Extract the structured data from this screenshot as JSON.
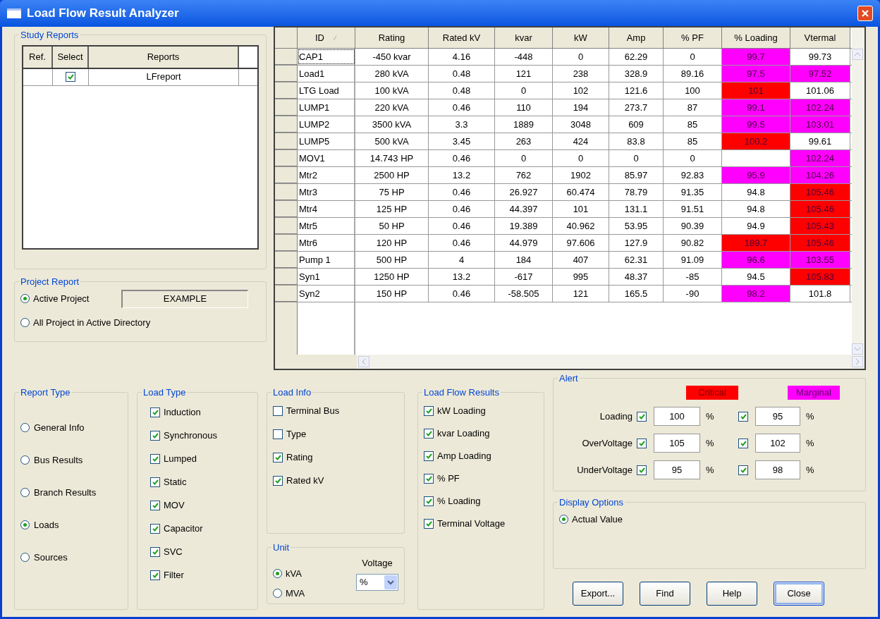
{
  "window": {
    "title": "Load Flow Result Analyzer"
  },
  "study_reports": {
    "title": "Study Reports",
    "columns": [
      "Ref.",
      "Select",
      "Reports"
    ],
    "rows": [
      {
        "select": true,
        "report": "LFreport"
      }
    ]
  },
  "project_report": {
    "title": "Project Report",
    "options": [
      {
        "label": "Active Project",
        "selected": true
      },
      {
        "label": "All Project in Active Directory",
        "selected": false
      }
    ],
    "project_name": "EXAMPLE"
  },
  "results_table": {
    "columns": [
      "ID",
      "Rating",
      "Rated kV",
      "kvar",
      "kW",
      "Amp",
      "% PF",
      "% Loading",
      "Vtermal"
    ],
    "rows": [
      {
        "focused": true,
        "cells": [
          "CAP1",
          "-450 kvar",
          "4.16",
          "-448",
          "0",
          "62.29",
          "0"
        ],
        "loading": {
          "text": "99.7",
          "color": "#ff00ff"
        },
        "vtermal": {
          "text": "99.73",
          "color": "#ffffff"
        }
      },
      {
        "focused": false,
        "cells": [
          "Load1",
          "280 kVA",
          "0.48",
          "121",
          "238",
          "328.9",
          "89.16"
        ],
        "loading": {
          "text": "97.5",
          "color": "#ff00ff"
        },
        "vtermal": {
          "text": "97.52",
          "color": "#ff00ff"
        }
      },
      {
        "focused": false,
        "cells": [
          "LTG Load",
          "100 kVA",
          "0.48",
          "0",
          "102",
          "121.6",
          "100"
        ],
        "loading": {
          "text": "101",
          "color": "#ff0000"
        },
        "vtermal": {
          "text": "101.06",
          "color": "#ffffff"
        }
      },
      {
        "focused": false,
        "cells": [
          "LUMP1",
          "220 kVA",
          "0.46",
          "110",
          "194",
          "273.7",
          "87"
        ],
        "loading": {
          "text": "99.1",
          "color": "#ff00ff"
        },
        "vtermal": {
          "text": "102.24",
          "color": "#ff00ff"
        }
      },
      {
        "focused": false,
        "cells": [
          "LUMP2",
          "3500 kVA",
          "3.3",
          "1889",
          "3048",
          "609",
          "85"
        ],
        "loading": {
          "text": "99.5",
          "color": "#ff00ff"
        },
        "vtermal": {
          "text": "103.01",
          "color": "#ff00ff"
        }
      },
      {
        "focused": false,
        "cells": [
          "LUMP5",
          "500 kVA",
          "3.45",
          "263",
          "424",
          "83.8",
          "85"
        ],
        "loading": {
          "text": "100.2",
          "color": "#ff0000"
        },
        "vtermal": {
          "text": "99.61",
          "color": "#ffffff"
        }
      },
      {
        "focused": false,
        "cells": [
          "MOV1",
          "14.743 HP",
          "0.46",
          "0",
          "0",
          "0",
          "0"
        ],
        "loading": {
          "color": "#ffffff"
        },
        "vtermal": {
          "text": "102.24",
          "color": "#ff00ff"
        }
      },
      {
        "focused": false,
        "cells": [
          "Mtr2",
          "2500 HP",
          "13.2",
          "762",
          "1902",
          "85.97",
          "92.83"
        ],
        "loading": {
          "text": "95.9",
          "color": "#ff00ff"
        },
        "vtermal": {
          "text": "104.26",
          "color": "#ff00ff"
        }
      },
      {
        "focused": false,
        "cells": [
          "Mtr3",
          "75 HP",
          "0.46",
          "26.927",
          "60.474",
          "78.79",
          "91.35"
        ],
        "loading": {
          "text": "94.8",
          "color": "#ffffff"
        },
        "vtermal": {
          "text": "105.46",
          "color": "#ff0000"
        }
      },
      {
        "focused": false,
        "cells": [
          "Mtr4",
          "125 HP",
          "0.46",
          "44.397",
          "101",
          "131.1",
          "91.51"
        ],
        "loading": {
          "text": "94.8",
          "color": "#ffffff"
        },
        "vtermal": {
          "text": "105.46",
          "color": "#ff0000"
        }
      },
      {
        "focused": false,
        "cells": [
          "Mtr5",
          "50 HP",
          "0.46",
          "19.389",
          "40.962",
          "53.95",
          "90.39"
        ],
        "loading": {
          "text": "94.9",
          "color": "#ffffff"
        },
        "vtermal": {
          "text": "105.43",
          "color": "#ff0000"
        }
      },
      {
        "focused": false,
        "cells": [
          "Mtr6",
          "120 HP",
          "0.46",
          "44.979",
          "97.606",
          "127.9",
          "90.82"
        ],
        "loading": {
          "text": "189.7",
          "color": "#ff0000"
        },
        "vtermal": {
          "text": "105.46",
          "color": "#ff0000"
        }
      },
      {
        "focused": false,
        "cells": [
          "Pump 1",
          "500 HP",
          "4",
          "184",
          "407",
          "62.31",
          "91.09"
        ],
        "loading": {
          "text": "96.6",
          "color": "#ff00ff"
        },
        "vtermal": {
          "text": "103.55",
          "color": "#ff00ff"
        }
      },
      {
        "focused": false,
        "cells": [
          "Syn1",
          "1250 HP",
          "13.2",
          "-617",
          "995",
          "48.37",
          "-85"
        ],
        "loading": {
          "text": "94.5",
          "color": "#ffffff"
        },
        "vtermal": {
          "text": "105.83",
          "color": "#ff0000"
        }
      },
      {
        "focused": false,
        "cells": [
          "Syn2",
          "150 HP",
          "0.46",
          "-58.505",
          "121",
          "165.5",
          "-90"
        ],
        "loading": {
          "text": "98.2",
          "color": "#ff00ff"
        },
        "vtermal": {
          "text": "101.8",
          "color": "#ffffff"
        }
      }
    ]
  },
  "report_type": {
    "title": "Report Type",
    "options": [
      {
        "label": "General Info",
        "selected": false
      },
      {
        "label": "Bus Results",
        "selected": false
      },
      {
        "label": "Branch Results",
        "selected": false
      },
      {
        "label": "Loads",
        "selected": true
      },
      {
        "label": "Sources",
        "selected": false
      }
    ]
  },
  "load_type": {
    "title": "Load Type",
    "items": [
      {
        "label": "Induction",
        "checked": true
      },
      {
        "label": "Synchronous",
        "checked": true
      },
      {
        "label": "Lumped",
        "checked": true
      },
      {
        "label": "Static",
        "checked": true
      },
      {
        "label": "MOV",
        "checked": true
      },
      {
        "label": "Capacitor",
        "checked": true
      },
      {
        "label": "SVC",
        "checked": true
      },
      {
        "label": "Filter",
        "checked": true
      }
    ]
  },
  "load_info": {
    "title": "Load Info",
    "items": [
      {
        "label": "Terminal Bus",
        "checked": false
      },
      {
        "label": "Type",
        "checked": false
      },
      {
        "label": "Rating",
        "checked": true
      },
      {
        "label": "Rated kV",
        "checked": true
      }
    ]
  },
  "unit": {
    "title": "Unit",
    "options": [
      {
        "label": "kVA",
        "selected": true
      },
      {
        "label": "MVA",
        "selected": false
      }
    ],
    "voltage_label": "Voltage",
    "voltage_value": "%"
  },
  "load_flow_results": {
    "title": "Load Flow Results",
    "items": [
      {
        "label": "kW Loading",
        "checked": true
      },
      {
        "label": "kvar Loading",
        "checked": true
      },
      {
        "label": "Amp Loading",
        "checked": true
      },
      {
        "label": "% PF",
        "checked": true
      },
      {
        "label": "% Loading",
        "checked": true
      },
      {
        "label": "Terminal Voltage",
        "checked": true
      }
    ]
  },
  "alert": {
    "title": "Alert",
    "critical_label": "Critical",
    "marginal_label": "Marginal",
    "rows": [
      {
        "label": "Loading",
        "critical_on": true,
        "critical_value": "100",
        "critical_unit": "%",
        "marginal_on": true,
        "marginal_value": "95",
        "marginal_unit": "%"
      },
      {
        "label": "OverVoltage",
        "critical_on": true,
        "critical_value": "105",
        "critical_unit": "%",
        "marginal_on": true,
        "marginal_value": "102",
        "marginal_unit": "%"
      },
      {
        "label": "UnderVoltage",
        "critical_on": true,
        "critical_value": "95",
        "critical_unit": "%",
        "marginal_on": true,
        "marginal_value": "98",
        "marginal_unit": "%"
      }
    ]
  },
  "display_options": {
    "title": "Display Options",
    "options": [
      {
        "label": "Actual Value",
        "selected": true
      }
    ]
  },
  "buttons": [
    {
      "label": "Export...",
      "default": false
    },
    {
      "label": "Find",
      "default": false
    },
    {
      "label": "Help",
      "default": false
    },
    {
      "label": "Close",
      "default": true
    }
  ]
}
